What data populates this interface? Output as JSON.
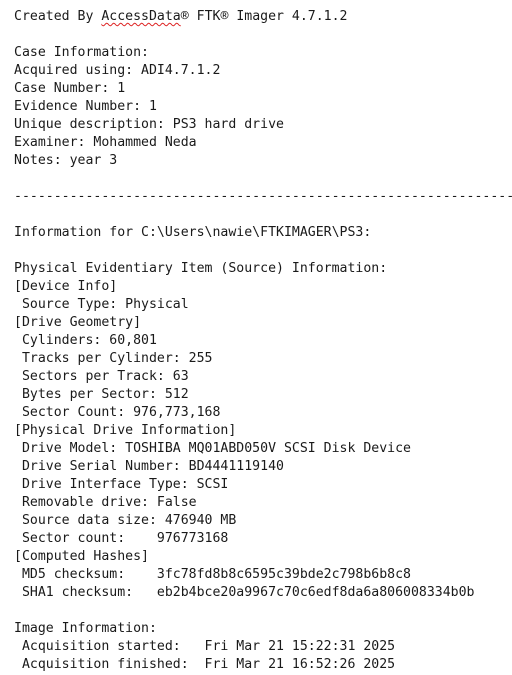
{
  "header": {
    "prefix": "Created By ",
    "company": "AccessData",
    "suffix": "® FTK® Imager 4.7.1.2"
  },
  "case_info": {
    "heading": "Case Information:",
    "acquired_using": "Acquired using: ADI4.7.1.2",
    "case_number": "Case Number: 1",
    "evidence_number": "Evidence Number: 1",
    "unique_description": "Unique description: PS3 hard drive",
    "examiner": "Examiner: Mohammed Neda",
    "notes": "Notes: year 3"
  },
  "separator": "--------------------------------------------------------------------",
  "information_for": "Information for C:\\Users\\nawie\\FTKIMAGER\\PS3:",
  "physical": {
    "heading": "Physical Evidentiary Item (Source) Information:",
    "device_info": "[Device Info]",
    "source_type": " Source Type: Physical",
    "drive_geometry": "[Drive Geometry]",
    "cylinders": " Cylinders: 60,801",
    "tracks_per_cylinder": " Tracks per Cylinder: 255",
    "sectors_per_track": " Sectors per Track: 63",
    "bytes_per_sector": " Bytes per Sector: 512",
    "sector_count": " Sector Count: 976,773,168",
    "physical_drive_info": "[Physical Drive Information]",
    "drive_model": " Drive Model: TOSHIBA MQ01ABD050V SCSI Disk Device",
    "drive_serial": " Drive Serial Number: BD4441119140",
    "drive_interface": " Drive Interface Type: SCSI",
    "removable": " Removable drive: False",
    "source_data_size": " Source data size: 476940 MB",
    "sector_count2": " Sector count:    976773168",
    "computed_hashes": "[Computed Hashes]",
    "md5": " MD5 checksum:    3fc78fd8b8c6595c39bde2c798b6b8c8",
    "sha1": " SHA1 checksum:   eb2b4bce20a9967c70c6edf8da6a806008334b0b"
  },
  "image_info": {
    "heading": "Image Information:",
    "acq_started": " Acquisition started:   Fri Mar 21 15:22:31 2025",
    "acq_finished": " Acquisition finished:  Fri Mar 21 16:52:26 2025"
  }
}
